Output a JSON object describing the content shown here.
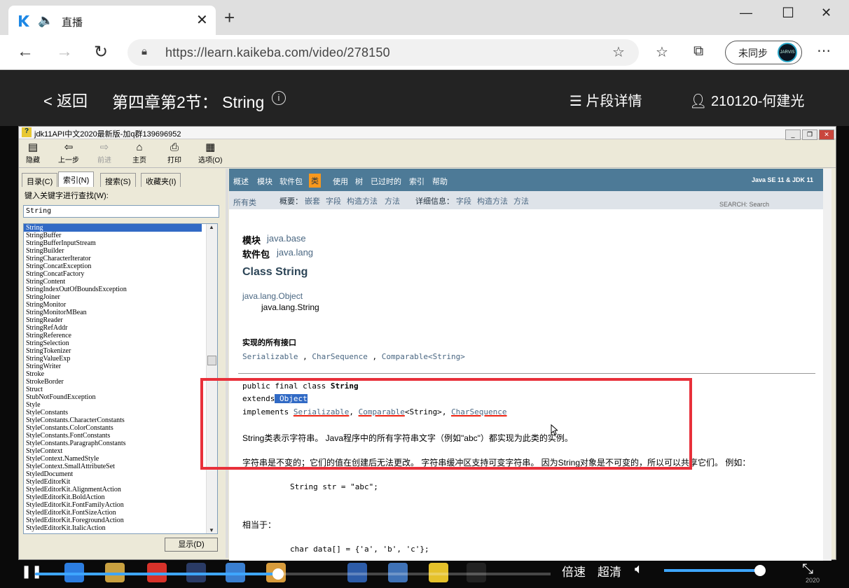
{
  "browser": {
    "tab_title": "直播",
    "url": "https://learn.kaikeba.com/video/278150",
    "sync_label": "未同步",
    "avatar_text": "JARVIS"
  },
  "header": {
    "back_label": "返回",
    "title": "第四章第2节： String",
    "segments_label": "片段详情",
    "user": "210120-何建光"
  },
  "app_window": {
    "title": "jdk11API中文2020最新版-加q群139696952",
    "toolbar": [
      {
        "label": "隐藏",
        "icon": "hide-icon"
      },
      {
        "label": "上一步",
        "icon": "back-arrow-icon"
      },
      {
        "label": "前进",
        "icon": "forward-arrow-icon"
      },
      {
        "label": "主页",
        "icon": "home-icon"
      },
      {
        "label": "打印",
        "icon": "print-icon"
      },
      {
        "label": "选项(O)",
        "icon": "options-icon"
      }
    ],
    "left_tabs": [
      "目录(C)",
      "索引(N)",
      "搜索(S)",
      "收藏夹(I)"
    ],
    "keyword_prompt": "键入关键字进行查找(W):",
    "search_value": "String",
    "index_items": [
      "String",
      "StringBuffer",
      "StringBufferInputStream",
      "StringBuilder",
      "StringCharacterIterator",
      "StringConcatException",
      "StringConcatFactory",
      "StringContent",
      "StringIndexOutOfBoundsException",
      "StringJoiner",
      "StringMonitor",
      "StringMonitorMBean",
      "StringReader",
      "StringRefAddr",
      "StringReference",
      "StringSelection",
      "StringTokenizer",
      "StringValueExp",
      "StringWriter",
      "Stroke",
      "StrokeBorder",
      "Struct",
      "StubNotFoundException",
      "Style",
      "StyleConstants",
      "StyleConstants.CharacterConstants",
      "StyleConstants.ColorConstants",
      "StyleConstants.FontConstants",
      "StyleConstants.ParagraphConstants",
      "StyleContext",
      "StyleContext.NamedStyle",
      "StyleContext.SmallAttributeSet",
      "StyledDocument",
      "StyledEditorKit",
      "StyledEditorKit.AlignmentAction",
      "StyledEditorKit.BoldAction",
      "StyledEditorKit.FontFamilyAction",
      "StyledEditorKit.FontSizeAction",
      "StyledEditorKit.ForegroundAction",
      "StyledEditorKit.ItalicAction"
    ],
    "display_button": "显示(D)"
  },
  "javadoc": {
    "nav": [
      "概述",
      "模块",
      "软件包",
      "类",
      "使用",
      "树",
      "已过时的",
      "索引",
      "帮助"
    ],
    "version": "Java SE 11 & JDK 11",
    "all_classes": "所有类",
    "summary_label": "概要：",
    "summary_items": [
      "嵌套",
      "字段",
      "构造方法",
      "方法"
    ],
    "detail_label": "详细信息：",
    "detail_items": [
      "字段",
      "构造方法",
      "方法"
    ],
    "search_label": "SEARCH:",
    "search_placeholder": "Search",
    "module_label": "模块",
    "module_value": "java.base",
    "package_label": "软件包",
    "package_value": "java.lang",
    "class_title": "Class String",
    "inherit_parent": "java.lang.Object",
    "inherit_child": "java.lang.String",
    "interfaces_heading": "实现的所有接口",
    "interfaces": [
      "Serializable",
      "CharSequence",
      "Comparable<String>"
    ],
    "decl_line1": "public final class ",
    "decl_class": "String",
    "decl_extends": "extends",
    "decl_object": "Object",
    "decl_implements": "implements ",
    "decl_serializable": "Serializable",
    "decl_comparable": "Comparable",
    "decl_generic": "<String>",
    "decl_charseq": "CharSequence",
    "desc1": "String类表示字符串。 Java程序中的所有字符串文字（例如\"abc\"）都实现为此类的实例。",
    "desc2": "字符串是不变的；它们的值在创建后无法更改。 字符串缓冲区支持可变字符串。 因为String对象是不可变的，所以可以共享它们。 例如：",
    "code1": "String str = \"abc\";",
    "equiv": "相当于：",
    "code2": "char data[] = {'a', 'b', 'c'};"
  },
  "player": {
    "speed_label": "倍速",
    "quality_label": "超清",
    "progress": 0.48,
    "volume": 0.95,
    "year_text": "2020"
  },
  "colors": {
    "accent": "#3ea6ff",
    "highlight_box": "#e8303a",
    "javadoc_nav": "#4d7a97"
  }
}
